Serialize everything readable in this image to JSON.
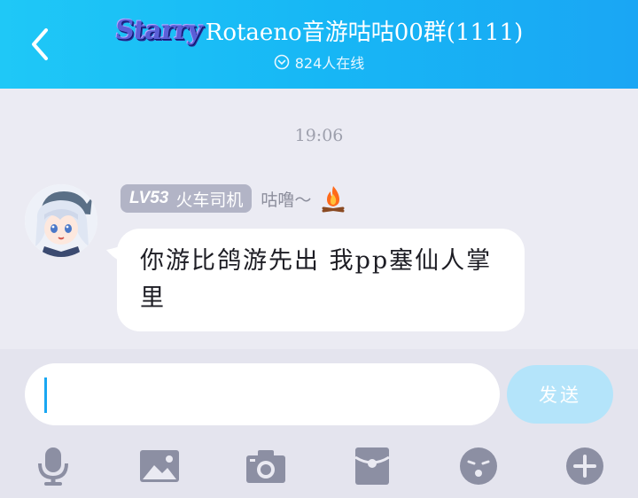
{
  "header": {
    "badge": "Starry",
    "title": "Rotaeno音游咕咕00群(1111)",
    "online": "824人在线",
    "colors": {
      "accent": "#17b7f5"
    }
  },
  "chat": {
    "timestamp": "19:06",
    "message": {
      "level": "LV53",
      "title_badge": "火车司机",
      "sender": "咕噜～",
      "text": "你游比鸽游先出 我pp塞仙人掌里"
    }
  },
  "input": {
    "placeholder": "",
    "send_label": "发送"
  },
  "toolbar": {
    "items": [
      "microphone-icon",
      "image-icon",
      "camera-icon",
      "red-packet-icon",
      "emoji-icon",
      "plus-icon"
    ]
  }
}
